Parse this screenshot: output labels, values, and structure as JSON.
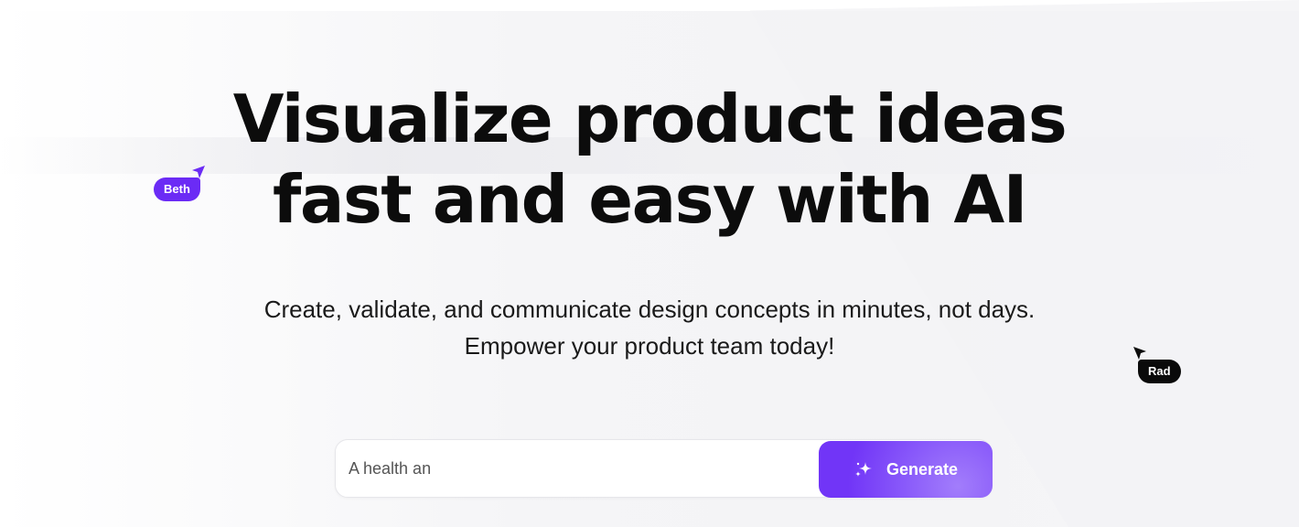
{
  "hero": {
    "headline_line1": "Visualize product ideas",
    "headline_line2": "fast and easy with AI",
    "subtitle_line1": "Create, validate, and communicate design concepts in minutes, not days.",
    "subtitle_line2": "Empower your product team today!"
  },
  "cursors": [
    {
      "label": "Beth",
      "color": "#6b2bf5",
      "icon": "cursor-arrow-icon"
    },
    {
      "label": "Rad",
      "color": "#0a0a0a",
      "icon": "cursor-arrow-icon"
    }
  ],
  "prompt": {
    "value": "A health an",
    "generate_label": "Generate",
    "generate_icon": "sparkle-icon",
    "accent": "#7135f7"
  }
}
